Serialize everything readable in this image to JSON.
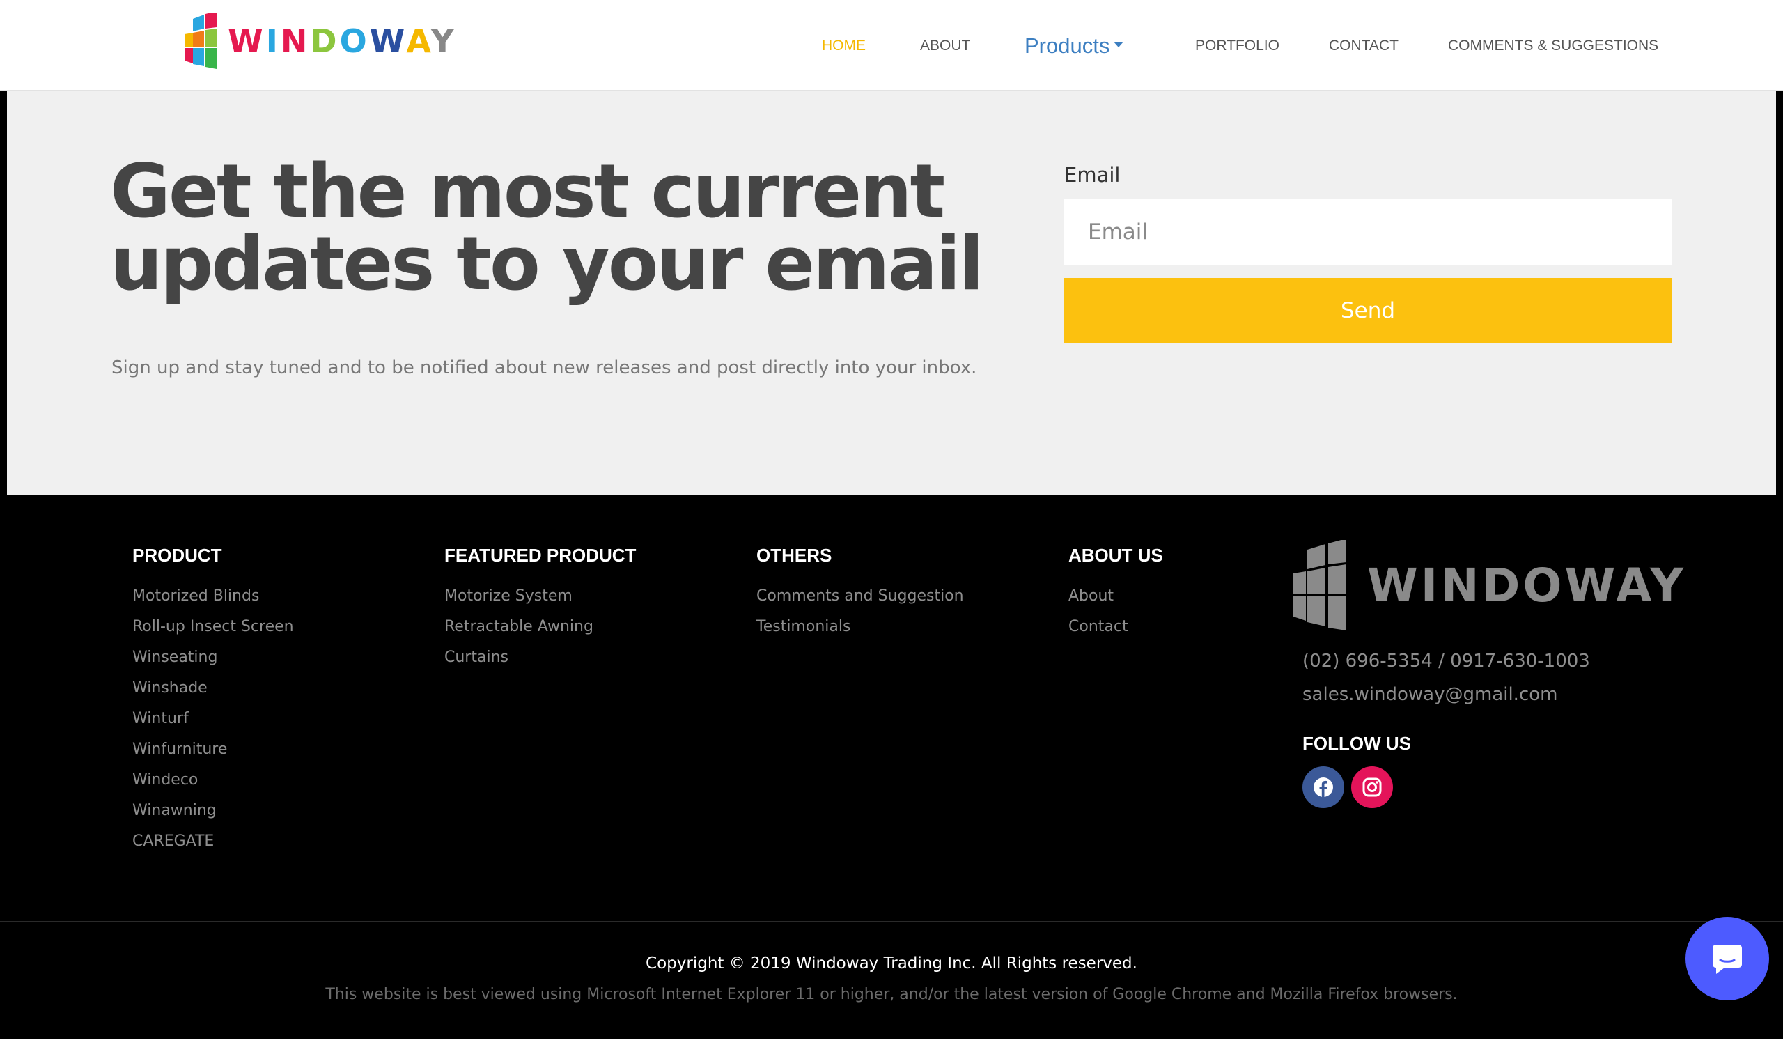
{
  "header": {
    "logo_text": "WINDOWAY",
    "nav": [
      {
        "label": "HOME",
        "active": true
      },
      {
        "label": "ABOUT"
      },
      {
        "label": "Products",
        "dropdown": true
      },
      {
        "label": "PORTFOLIO"
      },
      {
        "label": "CONTACT"
      },
      {
        "label": "COMMENTS & SUGGESTIONS"
      }
    ]
  },
  "newsletter": {
    "title": "Get the most current updates to your email",
    "subtitle": "Sign up and stay tuned and to be notified about new releases and post directly into your inbox.",
    "email_label": "Email",
    "email_placeholder": "Email",
    "send_label": "Send"
  },
  "footer": {
    "columns": [
      {
        "heading": "PRODUCT",
        "links": [
          "Motorized Blinds",
          "Roll-up Insect Screen",
          "Winseating",
          "Winshade",
          "Winturf",
          "Winfurniture",
          "Windeco",
          "Winawning",
          "CAREGATE"
        ]
      },
      {
        "heading": "FEATURED PRODUCT",
        "links": [
          "Motorize System",
          "Retractable Awning",
          "Curtains"
        ]
      },
      {
        "heading": "OTHERS",
        "links": [
          "Comments and Suggestion",
          "Testimonials"
        ]
      },
      {
        "heading": "ABOUT US",
        "links": [
          "About",
          "Contact"
        ]
      }
    ],
    "logo_text": "WINDOWAY",
    "phone": "(02) 696-5354 / 0917-630-1003",
    "email": "sales.windoway@gmail.com",
    "follow_heading": "FOLLOW US",
    "social": [
      "facebook-icon",
      "instagram-icon"
    ],
    "copyright": "Copyright © 2019 Windoway Trading Inc. All Rights reserved.",
    "browser_note": "This website is best viewed using Microsoft Internet Explorer 11 or higher, and/or the latest version of Google Chrome and Mozilla Firefox browsers."
  },
  "colors": {
    "accent_yellow": "#fcc10f",
    "nav_active": "#f5b800",
    "products_blue": "#3d7fc1",
    "facebook": "#3b5998",
    "instagram": "#e4145a",
    "chat": "#4d5bff"
  }
}
